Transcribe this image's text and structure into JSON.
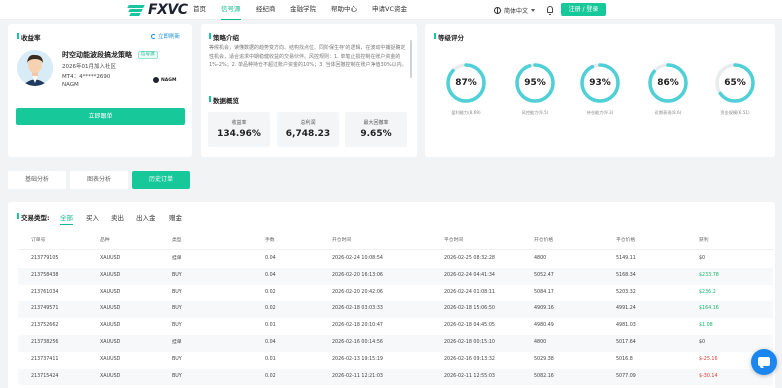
{
  "nav": {
    "logo_text": "FXVC",
    "items": [
      {
        "label": "首页",
        "active": false
      },
      {
        "label": "信号源",
        "active": true
      },
      {
        "label": "经纪商",
        "active": false
      },
      {
        "label": "金融学院",
        "active": false
      },
      {
        "label": "帮助中心",
        "active": false
      },
      {
        "label": "申请VC资金",
        "active": false
      }
    ],
    "language": "简体中文",
    "login_label": "注册 / 登录"
  },
  "profile": {
    "section_title": "收益率",
    "refresh_label": "立即刷新",
    "strategy_name": "时空动能波段搞龙策略",
    "tag": "信号源",
    "joined": "2026年01月加入社区",
    "account": "MT4：4*****2690",
    "broker": "NAGM",
    "broker_logo_text": "NAGM",
    "follow_label": "立即跟单"
  },
  "intro": {
    "title": "策略介绍",
    "text": "等候机会，读懂数据的趋势变方向、结构找点位、同阶保生存'的逻辑，在波动中捕捉确定性机会，适合追求中期稳健收益的交易伙伴。风控规则：1. 单笔止损控制在账户资金的1%-2%；2. 单品种持仓不超过账户资金的10%；3. 当体回撤控制在账户净值30%以内。"
  },
  "overview": {
    "title": "数据概览",
    "stats": [
      {
        "label": "收益率",
        "value": "134.96%"
      },
      {
        "label": "总利润",
        "value": "6,748.23"
      },
      {
        "label": "最大回撤率",
        "value": "9.65%"
      }
    ]
  },
  "rating": {
    "title": "等级评分",
    "gauges": [
      {
        "value": "87%",
        "pct": 87,
        "label": "盈利能力(8.69)"
      },
      {
        "value": "95%",
        "pct": 95,
        "label": "风控能力(9.5)"
      },
      {
        "value": "93%",
        "pct": 93,
        "label": "持仓能力(9.3)"
      },
      {
        "value": "86%",
        "pct": 86,
        "label": "近期表现(8.6)"
      },
      {
        "value": "65%",
        "pct": 65,
        "label": "资金规模(6.51)"
      }
    ]
  },
  "tabs": [
    {
      "label": "基础分析",
      "active": false
    },
    {
      "label": "图表分析",
      "active": false
    },
    {
      "label": "历史订单",
      "active": true
    }
  ],
  "filters": {
    "label": "交易类型:",
    "options": [
      {
        "label": "全部",
        "active": true
      },
      {
        "label": "买入",
        "active": false
      },
      {
        "label": "卖出",
        "active": false
      },
      {
        "label": "出入金",
        "active": false
      },
      {
        "label": "赠金",
        "active": false
      }
    ]
  },
  "table": {
    "headers": [
      "订单号",
      "品种",
      "类型",
      "手数",
      "开仓时间",
      "平仓时间",
      "开仓价格",
      "平仓价格",
      "获利"
    ],
    "rows": [
      {
        "cells": [
          "213779105",
          "XAUUSD",
          "挂单",
          "0.04",
          "2026-02-24 10:08:54",
          "2026-02-25 08:32:28",
          "4800",
          "5149.11",
          "$0"
        ],
        "profit_sign": "zero"
      },
      {
        "cells": [
          "213758438",
          "XAUUSD",
          "BUY",
          "0.04",
          "2026-02-20 16:13:06",
          "2026-02-24 04:41:34",
          "5052.47",
          "5168.34",
          "$233.78"
        ],
        "profit_sign": "pos"
      },
      {
        "cells": [
          "213761034",
          "XAUUSD",
          "BUY",
          "0.02",
          "2026-02-20 20:42:06",
          "2026-02-24 01:08:11",
          "5084.17",
          "5203.32",
          "$236.2"
        ],
        "profit_sign": "pos"
      },
      {
        "cells": [
          "213749571",
          "XAUUSD",
          "BUY",
          "0.02",
          "2026-02-18 03:03:33",
          "2026-02-18 15:06:50",
          "4909.16",
          "4991.24",
          "$164.16"
        ],
        "profit_sign": "pos"
      },
      {
        "cells": [
          "213752662",
          "XAUUSD",
          "BUY",
          "0.01",
          "2026-02-18 20:10:47",
          "2026-02-18 04:45:05",
          "4980.49",
          "4981.03",
          "$1.08"
        ],
        "profit_sign": "pos"
      },
      {
        "cells": [
          "213738256",
          "XAUUSD",
          "挂单",
          "0.04",
          "2026-02-16 00:14:56",
          "2026-02-18 00:15:10",
          "4800",
          "5017.64",
          "$0"
        ],
        "profit_sign": "zero"
      },
      {
        "cells": [
          "213737411",
          "XAUUSD",
          "BUY",
          "0.01",
          "2026-02-13 19:15:19",
          "2026-02-16 09:13:32",
          "5029.38",
          "5016.8",
          "$-25.16"
        ],
        "profit_sign": "neg"
      },
      {
        "cells": [
          "213715424",
          "XAUUSD",
          "BUY",
          "0.02",
          "2026-02-11 12:21:03",
          "2026-02-11 12:55:03",
          "5082.16",
          "5077.09",
          "$-30.14"
        ],
        "profit_sign": "neg"
      }
    ]
  },
  "colors": {
    "accent": "#17c89a",
    "link": "#1b8fd6",
    "positive": "#17b26a",
    "negative": "#e53935",
    "chat": "#1c86f0"
  }
}
